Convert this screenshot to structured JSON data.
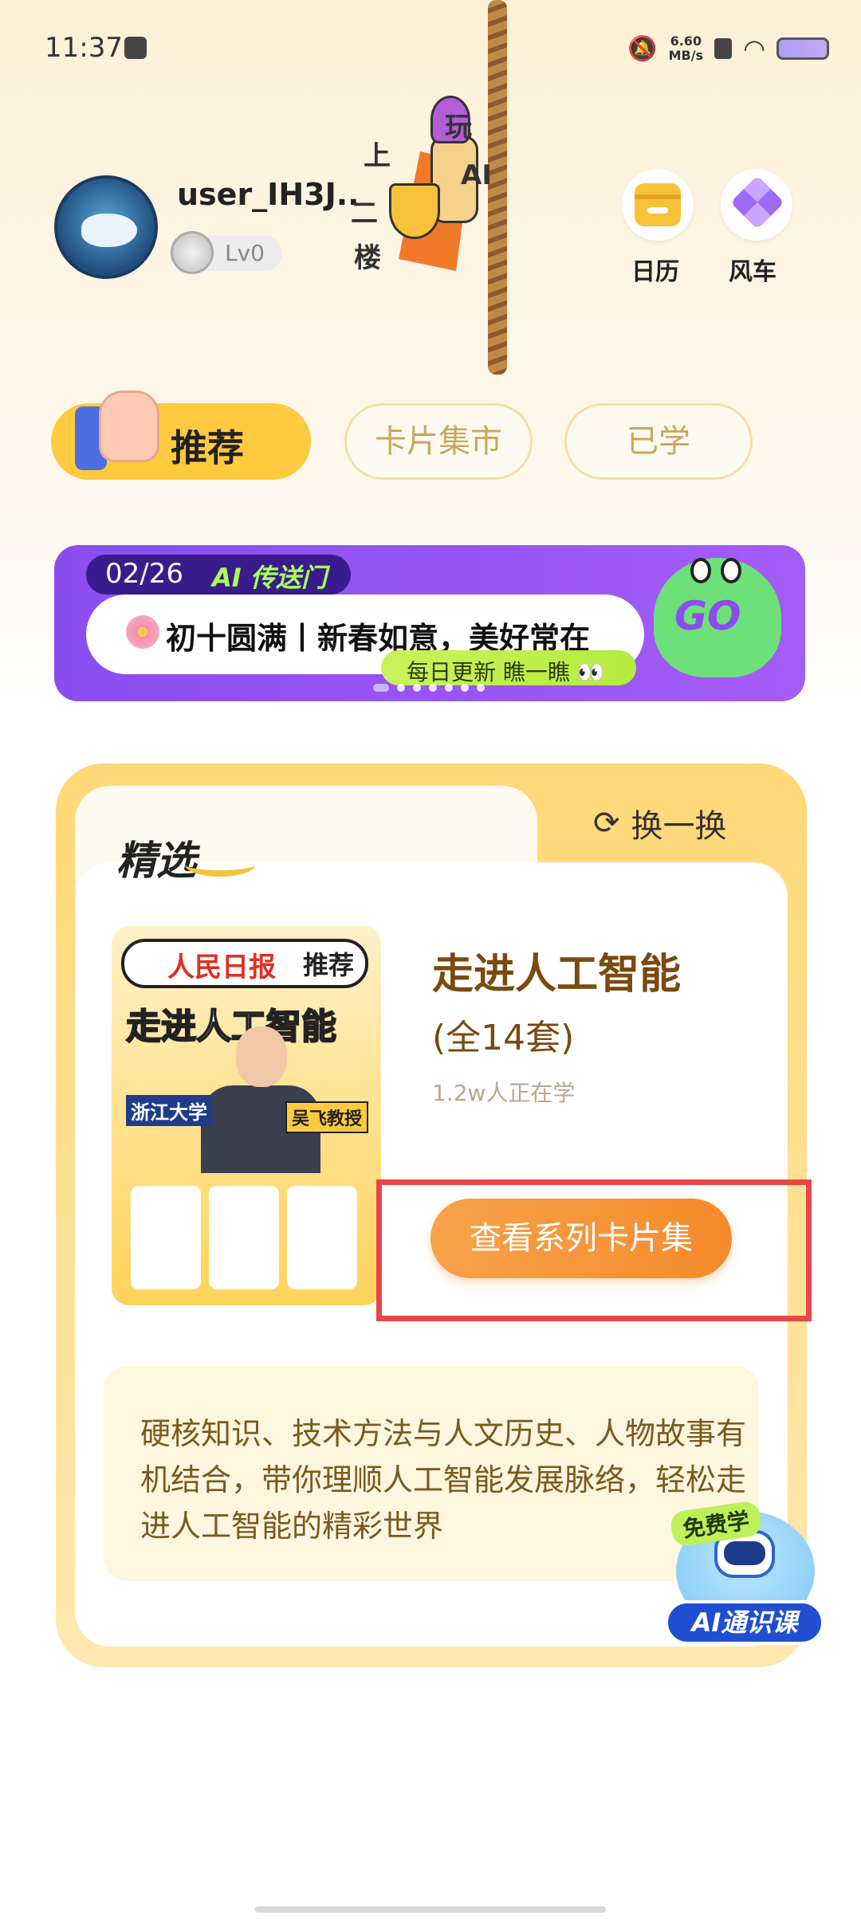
{
  "status_bar": {
    "time": "11:37",
    "net_speed_value": "6.60",
    "net_speed_unit": "MB/s"
  },
  "profile": {
    "username": "user_IH3J..",
    "level": "Lv0"
  },
  "top_actions": {
    "calendar_label": "日历",
    "windmill_label": "风车"
  },
  "decoration": {
    "chars": [
      "玩",
      "上",
      "AI",
      "二",
      "楼"
    ]
  },
  "tabs": {
    "recommend": "推荐",
    "market": "卡片集市",
    "learned": "已学"
  },
  "banner": {
    "date": "02/26",
    "tag": "AI 传送门",
    "title": "初十圆满丨新春如意，美好常在",
    "update": "每日更新 瞧一瞧 👀",
    "go": "GO",
    "page_count": 7,
    "active_page": 0
  },
  "featured": {
    "section_title": "精选",
    "refresh_label": "换一换",
    "poster": {
      "paper": "人民日报",
      "recommend": "推荐",
      "title": "走进人工智能",
      "university": "浙江大学",
      "professor": "吴飞教授"
    },
    "series_title": "走进人工智能",
    "series_count": "(全14套)",
    "learners": "1.2w人正在学",
    "cta": "查看系列卡片集",
    "description": "硬核知识、技术方法与人文历史、人物故事有机结合，带你理顺人工智能发展脉络，轻松走进人工智能的精彩世界"
  },
  "ai_course": {
    "free_tag": "免费学",
    "label": "AI通识课"
  },
  "colors": {
    "accent_yellow": "#ffc940",
    "cta_orange": "#f58a2c",
    "banner_purple": "#8b4df0",
    "highlight_red": "#e8474a"
  }
}
